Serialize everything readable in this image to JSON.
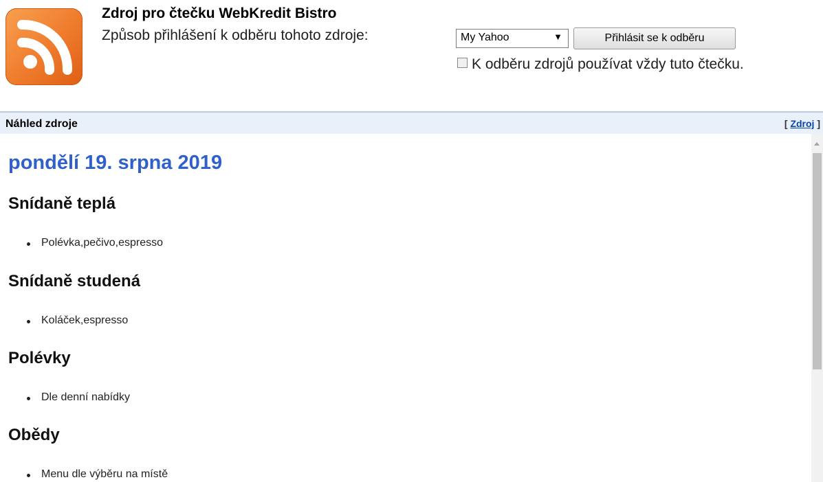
{
  "header": {
    "title": "Zdroj pro čtečku WebKredit Bistro",
    "subscribe_label": "Způsob přihlášení k odběru tohoto zdroje:",
    "reader_select": {
      "selected": "My Yahoo"
    },
    "subscribe_button": "Přihlásit se k odběru",
    "always_use_label": "K odběru zdrojů používat vždy tuto čtečku.",
    "icon": "rss-icon",
    "logo_colors": {
      "light": "#f8a050",
      "dark": "#de5f14"
    }
  },
  "preview": {
    "title": "Náhled zdroje",
    "link_prefix": "[",
    "link_label": "Zdroj",
    "link_suffix": "]"
  },
  "feed": {
    "date": "pondělí 19. srpna 2019",
    "date_color": "#3060cc",
    "sections": [
      {
        "title": "Snídaně teplá",
        "item": "Polévka,pečivo,espresso"
      },
      {
        "title": "Snídaně studená",
        "item": "Koláček,espresso"
      },
      {
        "title": "Polévky",
        "item": "Dle denní nabídky"
      },
      {
        "title": "Obědy",
        "item": "Menu dle výběru na místě"
      }
    ]
  }
}
